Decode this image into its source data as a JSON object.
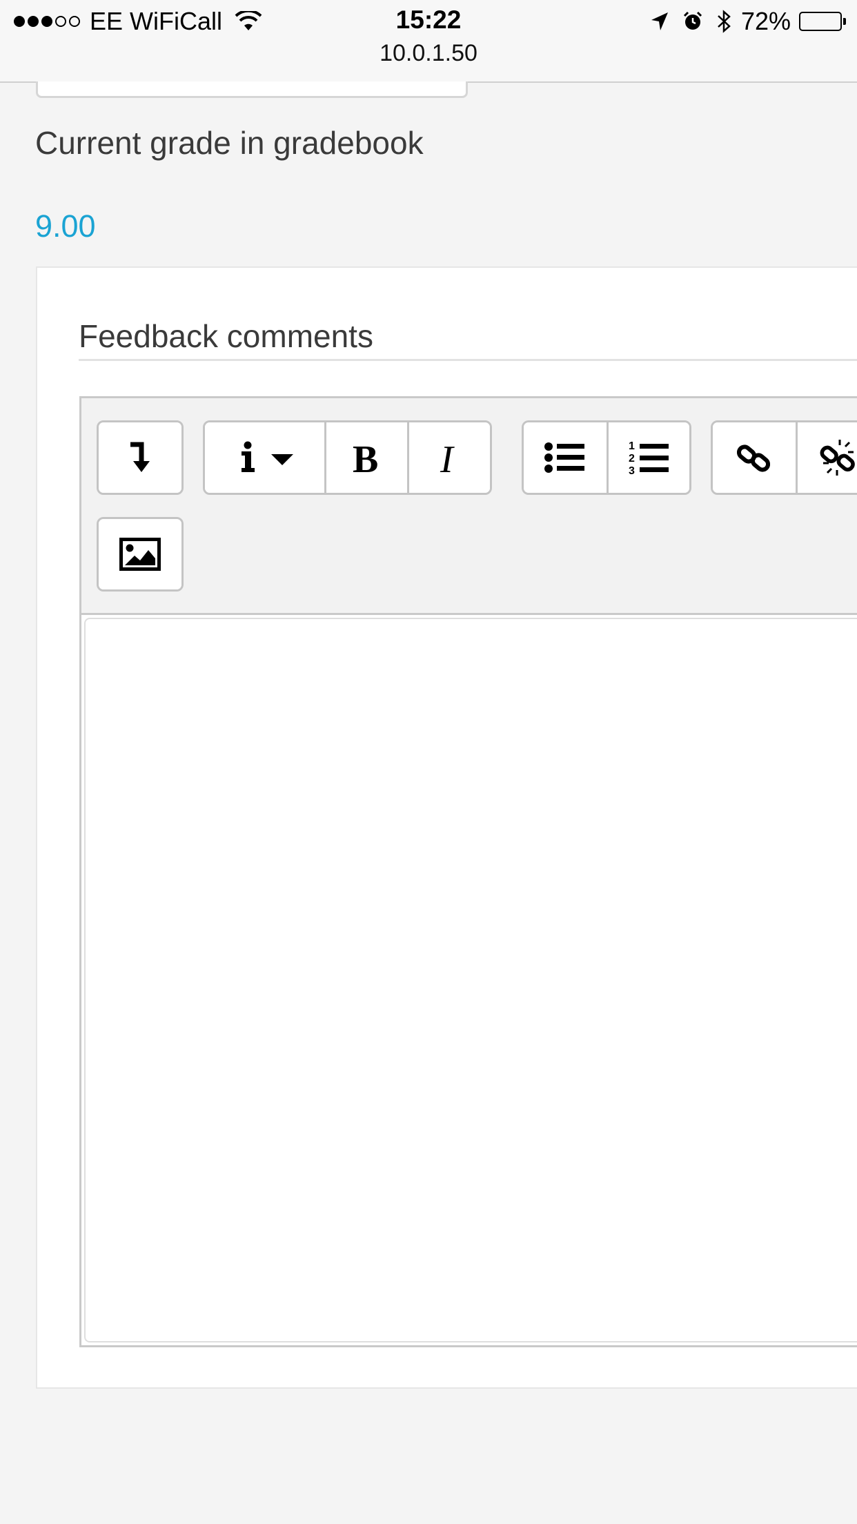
{
  "status_bar": {
    "signal": "●●●○○",
    "carrier": "EE WiFiCall",
    "time": "15:22",
    "url": "10.0.1.50",
    "battery_percent": "72%",
    "battery_level": 0.72,
    "icons": [
      "wifi-icon",
      "location-arrow-icon",
      "alarm-clock-icon",
      "bluetooth-icon",
      "battery-icon"
    ]
  },
  "grade": {
    "label": "Current grade in gradebook",
    "value": "9.00",
    "value_color": "#1aa3d3"
  },
  "feedback": {
    "title": "Feedback comments",
    "toolbar": {
      "buttons": [
        {
          "name": "collapse-toolbar",
          "icon": "arrow-down-turn-icon"
        },
        {
          "name": "paragraph-style",
          "icon": "info-dropdown-icon"
        },
        {
          "name": "bold",
          "icon": "bold-icon"
        },
        {
          "name": "italic",
          "icon": "italic-icon"
        },
        {
          "name": "unordered-list",
          "icon": "bullet-list-icon"
        },
        {
          "name": "ordered-list",
          "icon": "numbered-list-icon"
        },
        {
          "name": "link",
          "icon": "link-icon"
        },
        {
          "name": "unlink",
          "icon": "unlink-icon"
        },
        {
          "name": "insert-image",
          "icon": "image-icon"
        }
      ]
    },
    "content": ""
  }
}
